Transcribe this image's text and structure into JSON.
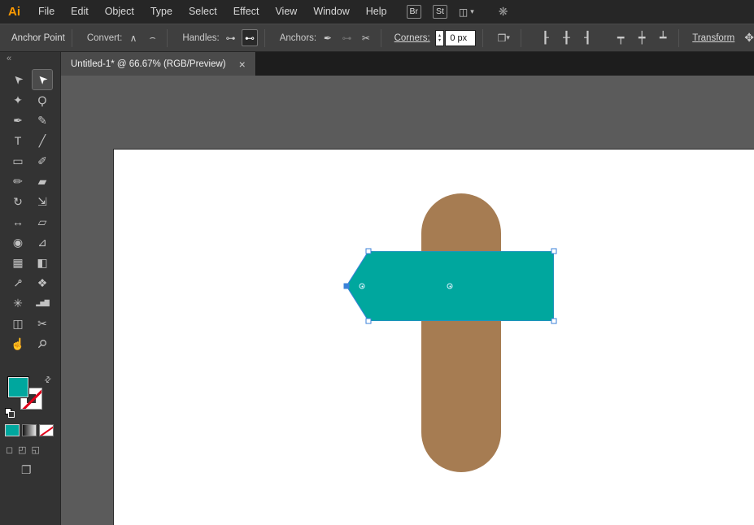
{
  "menubar": {
    "logo": "Ai",
    "menus": [
      "File",
      "Edit",
      "Object",
      "Type",
      "Select",
      "Effect",
      "View",
      "Window",
      "Help"
    ],
    "app_buttons": [
      "Br",
      "St"
    ],
    "workspace_icon_glyph": "◫",
    "workspace_chevron": "▾",
    "touch_icon_glyph": "❋"
  },
  "controlbar": {
    "context_label": "Anchor Point",
    "convert_label": "Convert:",
    "convert_buttons": [
      {
        "name": "convert-to-corner",
        "glyph": "∧"
      },
      {
        "name": "convert-to-smooth",
        "glyph": "⌢"
      }
    ],
    "handles_label": "Handles:",
    "handles_buttons": [
      {
        "name": "show-handles",
        "glyph": "⊶"
      },
      {
        "name": "hide-handles",
        "glyph": "⊷",
        "active": true
      }
    ],
    "anchors_label": "Anchors:",
    "anchors_buttons": [
      {
        "name": "remove-anchor",
        "glyph": "✒"
      },
      {
        "name": "connect-endpoints",
        "glyph": "⊶",
        "disabled": true
      },
      {
        "name": "cut-path",
        "glyph": "✂"
      }
    ],
    "corners_label": "Corners:",
    "corners_value": "0 px",
    "stepper_up": "▴",
    "stepper_down": "▾",
    "doc_icon_glyph": "❒",
    "doc_chevron": "▾",
    "align_icons": [
      {
        "name": "align-horizontal-left",
        "glyph": "┠"
      },
      {
        "name": "align-horizontal-center",
        "glyph": "╂"
      },
      {
        "name": "align-horizontal-right",
        "glyph": "┨"
      },
      {
        "name": "align-vertical-top",
        "glyph": "┯"
      },
      {
        "name": "align-vertical-center",
        "glyph": "┿"
      },
      {
        "name": "align-vertical-bottom",
        "glyph": "┷"
      }
    ],
    "transform_label": "Transform",
    "more_icon_glyph": "✥"
  },
  "tab": {
    "title": "Untitled-1* @ 66.67% (RGB/Preview)",
    "close_glyph": "×"
  },
  "toolbar": {
    "collapse_glyph": "«",
    "tools": [
      {
        "name": "selection-tool",
        "glyph": "➤",
        "rot": -135
      },
      {
        "name": "direct-selection-tool",
        "glyph": "➤",
        "rot": -135,
        "active": true
      },
      {
        "name": "magic-wand-tool",
        "glyph": "✦"
      },
      {
        "name": "lasso-tool",
        "glyph": "Ϙ"
      },
      {
        "name": "pen-tool",
        "glyph": "✒"
      },
      {
        "name": "curvature-tool",
        "glyph": "✎"
      },
      {
        "name": "type-tool",
        "glyph": "T"
      },
      {
        "name": "line-segment-tool",
        "glyph": "╱"
      },
      {
        "name": "rectangle-tool",
        "glyph": "▭"
      },
      {
        "name": "paintbrush-tool",
        "glyph": "✐"
      },
      {
        "name": "shaper-tool",
        "glyph": "✏"
      },
      {
        "name": "eraser-tool",
        "glyph": "▰"
      },
      {
        "name": "rotate-tool",
        "glyph": "↻"
      },
      {
        "name": "scale-tool",
        "glyph": "⇲"
      },
      {
        "name": "width-tool",
        "glyph": "↔"
      },
      {
        "name": "free-transform-tool",
        "glyph": "▱"
      },
      {
        "name": "shape-builder-tool",
        "glyph": "◉"
      },
      {
        "name": "perspective-grid-tool",
        "glyph": "⊿"
      },
      {
        "name": "mesh-tool",
        "glyph": "▦"
      },
      {
        "name": "gradient-tool",
        "glyph": "◧"
      },
      {
        "name": "eyedropper-tool",
        "glyph": "⊸",
        "rot": -45
      },
      {
        "name": "blend-tool",
        "glyph": "❖"
      },
      {
        "name": "symbol-sprayer-tool",
        "glyph": "✳"
      },
      {
        "name": "column-graph-tool",
        "glyph": "▂▅▇",
        "small": true
      },
      {
        "name": "artboard-tool",
        "glyph": "◫"
      },
      {
        "name": "slice-tool",
        "glyph": "✂"
      },
      {
        "name": "hand-tool",
        "glyph": "☝"
      },
      {
        "name": "zoom-tool",
        "glyph": "⚲",
        "rot": 45
      }
    ],
    "swatches": {
      "fill_color": "#00A79E",
      "stroke_style": "none",
      "swap_glyph": "⇄"
    },
    "draw_mode_glyphs": [
      "◻",
      "◰",
      "◱"
    ],
    "screen_mode_glyph": "❐"
  },
  "canvas": {
    "artboard": {
      "background": "#ffffff"
    },
    "shapes": {
      "capsule": {
        "color": "#A67C52"
      },
      "banner": {
        "color": "#00A79E"
      }
    },
    "selection": {
      "color": "#3B82D9",
      "handle_fill": "#ffffff"
    }
  }
}
